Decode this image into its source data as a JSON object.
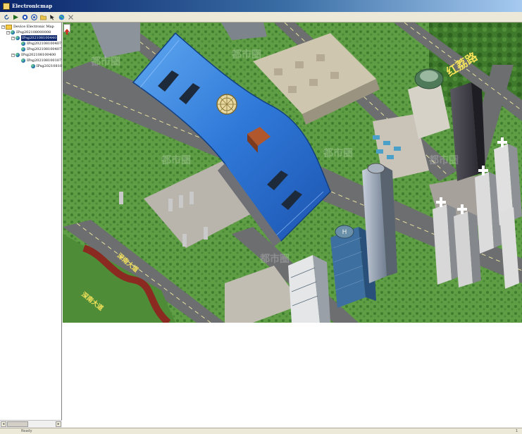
{
  "window": {
    "title": "Electronicmap"
  },
  "toolbar": {
    "buttons": [
      {
        "name": "refresh-icon"
      },
      {
        "name": "play-icon"
      },
      {
        "name": "stop-icon"
      },
      {
        "name": "record-icon"
      },
      {
        "name": "folder-icon"
      },
      {
        "name": "pointer-icon"
      },
      {
        "name": "globe-icon"
      },
      {
        "name": "delete-icon"
      }
    ]
  },
  "tree": {
    "root": "Device Electronic Map",
    "nodes": [
      {
        "label": "IPsg202108000008",
        "level": 1,
        "expanded": true
      },
      {
        "label": "IPsg202108100440",
        "level": 2,
        "expanded": true,
        "selected": true
      },
      {
        "label": "IPsg202108100407",
        "level": 3
      },
      {
        "label": "IPsg202108100407",
        "level": 3
      },
      {
        "label": "IPsg202108100400",
        "level": 2,
        "expanded": true
      },
      {
        "label": "IPsg202108100107",
        "level": 3
      },
      {
        "label": "IPsg20210810",
        "level": 4
      }
    ]
  },
  "map": {
    "road_labels": [
      "红荔路",
      "深南大道",
      "深南大道"
    ],
    "watermark": "都市圈"
  },
  "statusbar": {
    "left": "Ready",
    "right": "1"
  }
}
